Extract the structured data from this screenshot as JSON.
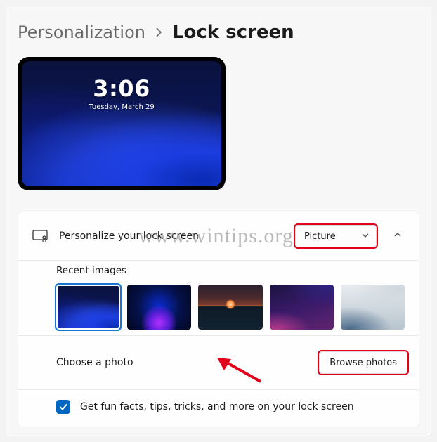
{
  "breadcrumb": {
    "parent": "Personalization",
    "current": "Lock screen"
  },
  "preview": {
    "time": "3:06",
    "date": "Tuesday, March 29"
  },
  "lockscreen": {
    "title": "Personalize your lock screen",
    "mode_selected": "Picture",
    "recent_label": "Recent images",
    "choose_label": "Choose a photo",
    "browse_label": "Browse photos",
    "funfacts_label": "Get fun facts, tips, tricks, and more on your lock screen",
    "funfacts_checked": true
  },
  "watermark": "www.wintips.org"
}
